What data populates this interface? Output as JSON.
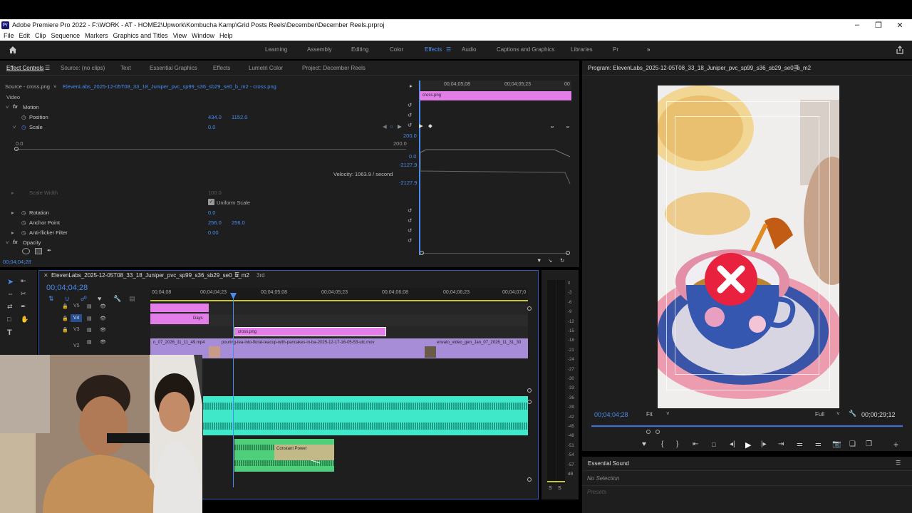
{
  "titlebar": {
    "title": "Adobe Premiere Pro 2022 - F:\\WORK - AT - HOME2\\Upwork\\Kombucha Kamp\\Grid Posts Reels\\December\\December Reels.prproj",
    "app_icon": "Pr"
  },
  "menu": [
    "File",
    "Edit",
    "Clip",
    "Sequence",
    "Markers",
    "Graphics and Titles",
    "View",
    "Window",
    "Help"
  ],
  "workspaces": [
    "Learning",
    "Assembly",
    "Editing",
    "Color",
    "Effects",
    "Audio",
    "Captions and Graphics",
    "Libraries",
    "Pr"
  ],
  "active_workspace": "Effects",
  "panel_tabs": [
    "Effect Controls",
    "Source: (no clips)",
    "Text",
    "Essential Graphics",
    "Effects",
    "Lumetri Color",
    "Project: December Reels"
  ],
  "effect_controls": {
    "source": "Source - cross.png",
    "sequence_clip": "ElevenLabs_2025-12-05T08_33_18_Juniper_pvc_sp99_s36_sb29_se0_b_m2 - cross.png",
    "video_label": "Video",
    "motion": "Motion",
    "position_label": "Position",
    "position_x": "434.0",
    "position_y": "1152.0",
    "scale_label": "Scale",
    "scale_value": "0.0",
    "graph_min": "0.0",
    "graph_max": "200.0",
    "graph_right_top": "200.0",
    "graph_right_mid": "0.0",
    "graph_right_neg": "-2127.9",
    "graph_right_neg2": "-2127.9",
    "velocity": "Velocity: 1063.9 / second",
    "scale_width_label": "Scale Width",
    "scale_width_value": "100.0",
    "uniform_scale": "Uniform Scale",
    "rotation_label": "Rotation",
    "rotation_value": "0.0",
    "anchor_label": "Anchor Point",
    "anchor_x": "256.0",
    "anchor_y": "256.0",
    "antiflicker_label": "Anti-flicker Filter",
    "antiflicker_value": "0.00",
    "opacity_label": "Opacity",
    "timecode": "00;04;04;28",
    "ruler": [
      "00;04;05;08",
      "00;04;05;23",
      "00"
    ],
    "clip_name": "cross.png"
  },
  "program": {
    "title": "Program: ElevenLabs_2025-12-05T08_33_18_Juniper_pvc_sp99_s36_sb29_se0_b_m2",
    "timecode": "00;04;04;28",
    "fit": "Fit",
    "quality": "Full",
    "duration": "00;00;29;12"
  },
  "timeline": {
    "tab": "ElevenLabs_2025-12-05T08_33_18_Juniper_pvc_sp99_s36_sb29_se0_b_m2",
    "tab2": "3rd",
    "timecode": "00;04;04;28",
    "ruler": [
      "00;04;08",
      "00;04;04;23",
      "00;04;05;08",
      "00;04;05;23",
      "00;04;06;08",
      "00;04;06;23",
      "00;04;07;0"
    ],
    "tracks": [
      "V5",
      "V4",
      "V3",
      "V2"
    ],
    "clips": {
      "days": "Days",
      "cross": "cross.png",
      "v2a": "n_07_2026_11_11_49.mp4",
      "v2b": "pouring-tea-into-floral-teacup-with-pancakes-in-ba-2025-12-17-16-05-53-utc.mov",
      "v2c": "envato_video_gen_Jan_07_2026_11_31_30",
      "audio_fx": "Constant Power"
    }
  },
  "meter": [
    "0",
    "-3",
    "-6",
    "-9",
    "-12",
    "-15",
    "-18",
    "-21",
    "-24",
    "-27",
    "-30",
    "-33",
    "-36",
    "-39",
    "-42",
    "-45",
    "-48",
    "-51",
    "-54",
    "-57",
    "dB"
  ],
  "meter_solo": [
    "S",
    "S"
  ],
  "essential_sound": {
    "title": "Essential Sound",
    "no_selection": "No Selection",
    "presets": "Presets"
  },
  "icons": [
    "home-icon",
    "share-icon",
    "hamburger-icon",
    "play-icon",
    "step-back-icon",
    "step-forward-icon",
    "wrench-icon",
    "marker-icon",
    "camera-icon",
    "plus-icon"
  ],
  "colors": {
    "accent": "#4a8cf0",
    "pink_clip": "#e37ee8",
    "purple_clip": "#a78dd8",
    "audio_clip": "#44e0c3",
    "cross_red": "#e8213f"
  }
}
